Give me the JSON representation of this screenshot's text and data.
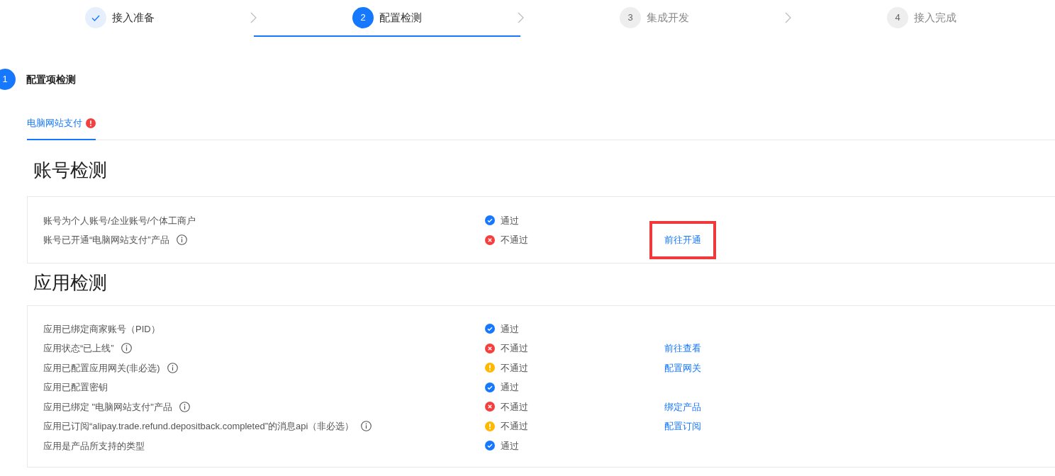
{
  "steps": [
    {
      "label": "接入准备",
      "kind": "done",
      "selected": false
    },
    {
      "number": "2",
      "label": "配置检测",
      "kind": "current",
      "selected": true
    },
    {
      "number": "3",
      "label": "集成开发",
      "kind": "pending",
      "selected": false
    },
    {
      "number": "4",
      "label": "接入完成",
      "kind": "pending",
      "selected": false
    }
  ],
  "section": {
    "number": "1",
    "title": "配置项检测"
  },
  "tabs": [
    {
      "label": "电脑网站支付",
      "selected": true,
      "alert": true
    }
  ],
  "groups": [
    {
      "title": "账号检测",
      "rows": [
        {
          "label": "账号为个人账号/企业账号/个体工商户",
          "info": false,
          "kind": "pass",
          "result_text": "通过"
        },
        {
          "label": "账号已开通“电脑网站支付”产品",
          "info": true,
          "kind": "fail",
          "result_text": "不通过",
          "action": "前往开通",
          "highlighted": true
        }
      ]
    },
    {
      "title": "应用检测",
      "rows": [
        {
          "label": "应用已绑定商家账号（PID）",
          "info": false,
          "kind": "pass",
          "result_text": "通过"
        },
        {
          "label": "应用状态“已上线”",
          "info": true,
          "kind": "fail",
          "result_text": "不通过",
          "action": "前往查看",
          "highlighted": false
        },
        {
          "label": "应用已配置应用网关(非必选)",
          "info": true,
          "kind": "warn",
          "result_text": "不通过",
          "action": "配置网关",
          "highlighted": false
        },
        {
          "label": "应用已配置密钥",
          "info": false,
          "kind": "pass",
          "result_text": "通过"
        },
        {
          "label": "应用已绑定 \"电脑网站支付\"产品",
          "info": true,
          "kind": "fail",
          "result_text": "不通过",
          "action": "绑定产品",
          "highlighted": false
        },
        {
          "label": "应用已订阅“alipay.trade.refund.depositback.completed”的消息api（非必选）",
          "info": true,
          "kind": "warn",
          "result_text": "不通过",
          "action": "配置订阅",
          "highlighted": false
        },
        {
          "label": "应用是产品所支持的类型",
          "info": false,
          "kind": "pass",
          "result_text": "通过"
        }
      ]
    }
  ]
}
